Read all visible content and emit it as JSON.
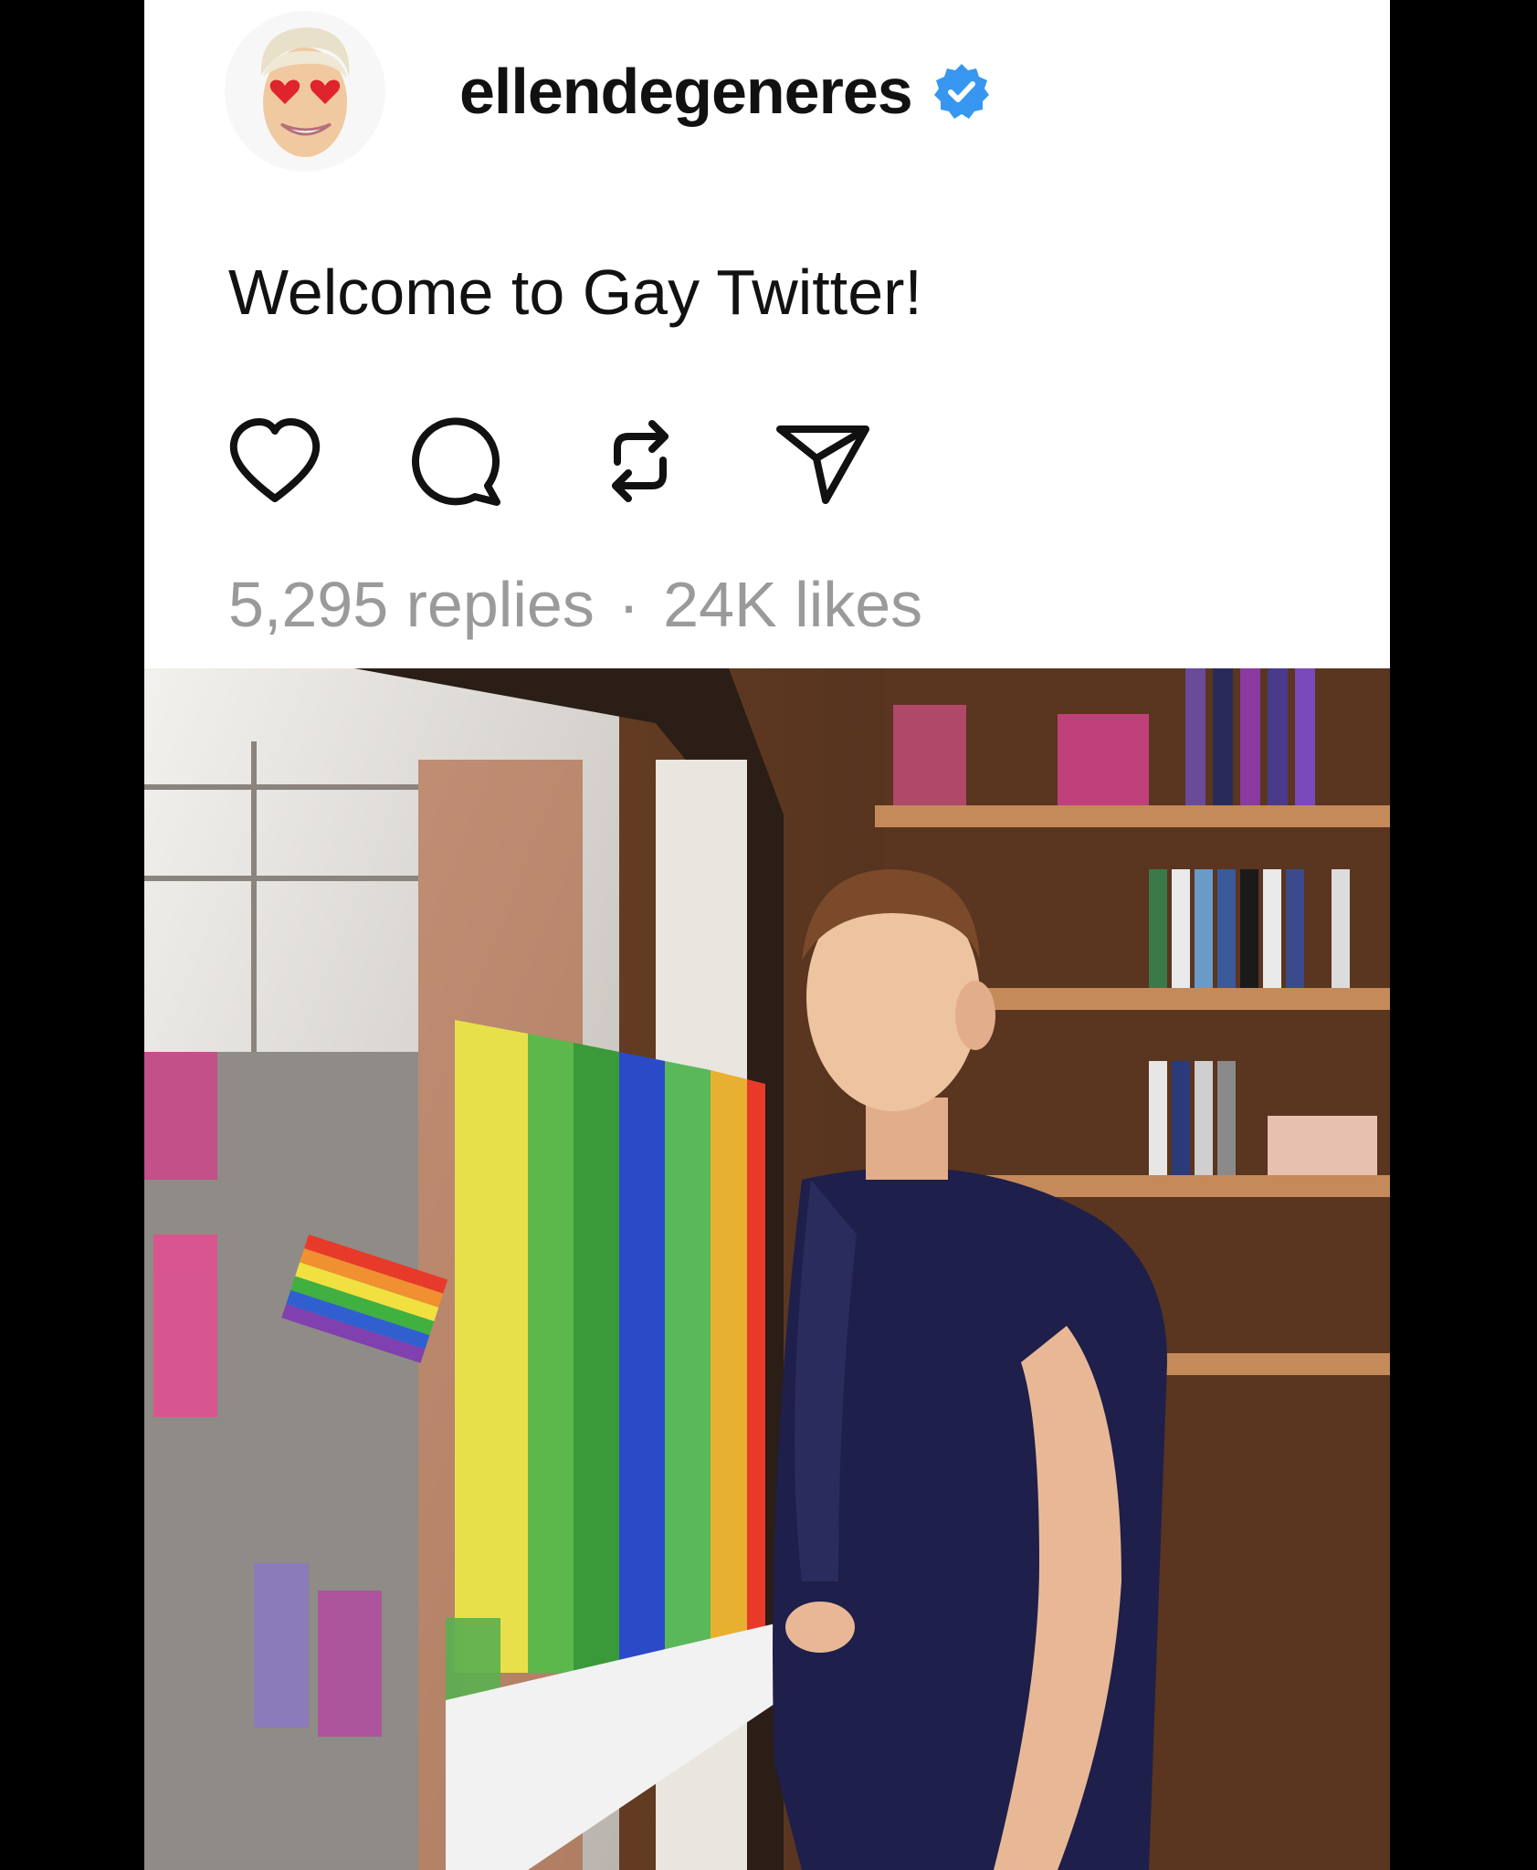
{
  "post": {
    "username": "ellendegeneres",
    "verified": true,
    "caption": "Welcome to Gay Twitter!",
    "replies": "5,295 replies",
    "separator": "·",
    "likes": "24K likes"
  },
  "actions": [
    {
      "name": "like",
      "icon": "heart-icon"
    },
    {
      "name": "reply",
      "icon": "comment-icon"
    },
    {
      "name": "repost",
      "icon": "repost-icon"
    },
    {
      "name": "share",
      "icon": "send-icon"
    }
  ],
  "colors": {
    "verified_badge": "#3797f0",
    "stats_text": "#9a9a9a",
    "text": "#111111",
    "background": "#ffffff",
    "frame": "#000000"
  },
  "media": {
    "description_icon": "photo-image"
  }
}
